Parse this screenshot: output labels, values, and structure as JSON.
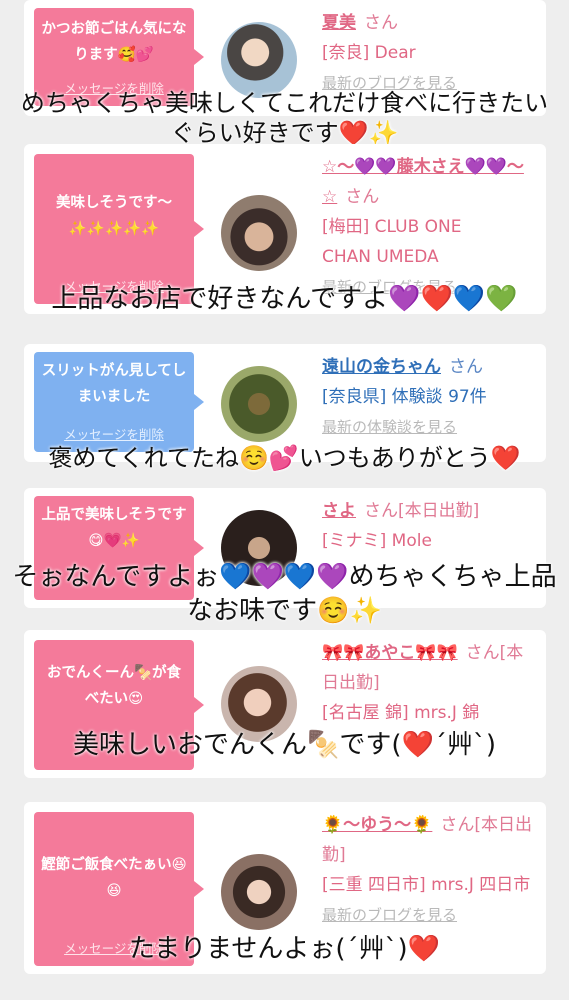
{
  "delete_label": "メッセージを削除",
  "cards": [
    {
      "bubble": "かつお節ごはん気になります🥰💕",
      "bubble_color": "#f47a9a",
      "name": "夏美",
      "san": "さん",
      "lines": [
        "[奈良] Dear"
      ],
      "link": "最新のブログを見る",
      "overlay": "めちゃくちゃ美味しくてこれだけ食べに行きたいぐらい好きです❤️✨"
    },
    {
      "bubble": "美味しそうです〜✨✨✨✨✨",
      "bubble_color": "#f47a9a",
      "name": "☆〜💜💜藤木さえ💜💜〜☆",
      "san": "さん",
      "lines": [
        "[梅田] CLUB ONE",
        "CHAN UMEDA"
      ],
      "link": "最新のブログを見る",
      "overlay": "上品なお店で好きなんですよ💜❤️💙💚"
    },
    {
      "bubble": "スリットがん見してしまいました",
      "bubble_color": "#7fb1f0",
      "name": "遠山の金ちゃん",
      "san": "さん",
      "lines": [
        "[奈良県] 体験談 97件"
      ],
      "link": "最新の体験談を見る",
      "overlay": "褒めてくれてたね☺️💕いつもありがとう❤️"
    },
    {
      "bubble": "上品で美味しそうです😋💗✨",
      "bubble_color": "#f47a9a",
      "name": "さよ",
      "san": "さん[本日出勤]",
      "lines": [
        "[ミナミ] Mole"
      ],
      "link": "最新のブログを見る",
      "overlay": "そぉなんですよぉ💙💜💙💜めちゃくちゃ上品なお味です☺️✨"
    },
    {
      "bubble": "おでんくーん🍢が食べたい😍",
      "bubble_color": "#f47a9a",
      "name": "🎀🎀あやこ🎀🎀",
      "san": "さん[本日出勤]",
      "lines": [
        "[名古屋 錦] mrs.J 錦"
      ],
      "link": "最新のブログを見る",
      "overlay": "美味しいおでんくん🍢です(❤️´艸`)"
    },
    {
      "bubble": "鰹節ご飯食べたぁい😆😆",
      "bubble_color": "#f47a9a",
      "name": "🌻〜ゆう〜🌻",
      "san": "さん[本日出勤]",
      "lines": [
        "[三重 四日市] mrs.J 四日市"
      ],
      "link": "最新のブログを見る",
      "overlay": "たまりませんよぉ(´艸`)❤️"
    }
  ]
}
